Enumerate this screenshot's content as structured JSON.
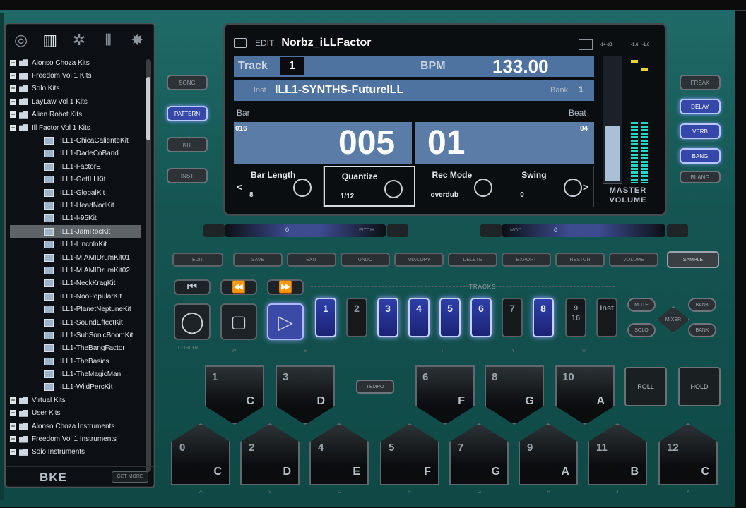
{
  "browser": {
    "tabs": [
      "disc-icon",
      "keyboard-icon",
      "gear-icon",
      "mixer-icon",
      "burst-icon"
    ],
    "items": [
      {
        "label": "Alonso Choza Kits",
        "type": "folder"
      },
      {
        "label": "Freedom Vol 1 Kits",
        "type": "folder"
      },
      {
        "label": "Solo Kits",
        "type": "folder"
      },
      {
        "label": "LayLaw Vol 1 Kits",
        "type": "folder"
      },
      {
        "label": "Alien Robot Kits",
        "type": "folder"
      },
      {
        "label": "Ill Factor Vol 1 Kits",
        "type": "folder"
      },
      {
        "label": "ILL1-ChicaCalienteKit",
        "type": "kit"
      },
      {
        "label": "ILL1-DadeCoBand",
        "type": "kit"
      },
      {
        "label": "ILL1-FactorE",
        "type": "kit"
      },
      {
        "label": "ILL1-GetILLKit",
        "type": "kit"
      },
      {
        "label": "ILL1-GlobalKit",
        "type": "kit"
      },
      {
        "label": "ILL1-HeadNodKit",
        "type": "kit"
      },
      {
        "label": "ILL1-I-95Kit",
        "type": "kit"
      },
      {
        "label": "ILL1-JamRocKit",
        "type": "kit",
        "selected": true
      },
      {
        "label": "ILL1-LincolnKit",
        "type": "kit"
      },
      {
        "label": "ILL1-MIAMIDrumKit01",
        "type": "kit"
      },
      {
        "label": "ILL1-MIAMIDrumKit02",
        "type": "kit"
      },
      {
        "label": "ILL1-NeckKragKit",
        "type": "kit"
      },
      {
        "label": "ILL1-NooPopularKit",
        "type": "kit"
      },
      {
        "label": "ILL1-PlanetNeptuneKit",
        "type": "kit"
      },
      {
        "label": "ILL1-SoundEffectKit",
        "type": "kit"
      },
      {
        "label": "ILL1-SubSonicBoomKit",
        "type": "kit"
      },
      {
        "label": "ILL1-TheBangFactor",
        "type": "kit"
      },
      {
        "label": "ILL1-TheBasics",
        "type": "kit"
      },
      {
        "label": "ILL1-TheMagicMan",
        "type": "kit"
      },
      {
        "label": "ILL1-WildPercKit",
        "type": "kit"
      },
      {
        "label": "Virtual Kits",
        "type": "folder"
      },
      {
        "label": "User Kits",
        "type": "folder"
      },
      {
        "label": "Alonso Choza Instruments",
        "type": "folder"
      },
      {
        "label": "Freedom Vol 1 Instruments",
        "type": "folder"
      },
      {
        "label": "Solo Instruments",
        "type": "folder"
      }
    ],
    "logo": "BKE",
    "footer_button": "GET MORE"
  },
  "display": {
    "edit_label": "EDIT",
    "name": "Norbz_iLLFactor",
    "track_label": "Track",
    "track_value": "1",
    "bpm_label": "BPM",
    "bpm_value": "133.00",
    "inst_label": "Inst",
    "inst_value": "ILL1-SYNTHS-FutureILL",
    "bank_label": "Bank",
    "bank_value": "1",
    "bar_label": "Bar",
    "beat_label": "Beat",
    "bar_total": "016",
    "bar_value": "005",
    "beat_value": "01",
    "beat_total": "04",
    "params": [
      {
        "label": "Bar Length",
        "value": "8"
      },
      {
        "label": "Quantize",
        "value": "1/12",
        "boxed": true
      },
      {
        "label": "Rec Mode",
        "value": "overdub"
      },
      {
        "label": "Swing",
        "value": "0"
      }
    ],
    "meter_labels": [
      "-14 dB",
      "-1.6",
      "-1.6"
    ],
    "master_label": "MASTER VOLUME",
    "meter_level": 0.45
  },
  "mode_buttons": [
    {
      "label": "SONG",
      "on": false
    },
    {
      "label": "PATTERN",
      "on": true
    },
    {
      "label": "KIT",
      "on": false
    },
    {
      "label": "INST",
      "on": false
    }
  ],
  "fx_buttons": [
    {
      "label": "FREAK",
      "on": false
    },
    {
      "label": "DELAY",
      "on": true
    },
    {
      "label": "VERB",
      "on": true
    },
    {
      "label": "BANG",
      "on": true
    },
    {
      "label": "BLANG",
      "on": false
    }
  ],
  "wheels": {
    "pitch": "PITCH",
    "mod": "MOD",
    "pitch_value": "0",
    "mod_value": "0"
  },
  "toolbar": [
    "EDIT",
    "SAVE",
    "EXIT",
    "UNDO",
    "MIXCOPY",
    "DELETE",
    "EXPORT",
    "RESTOR",
    "VOLUME",
    "SAMPLE"
  ],
  "transport": {
    "record_sub": "CORL+R"
  },
  "tracks_label": "TRACKS",
  "tracks": [
    {
      "label": "1",
      "on": true
    },
    {
      "label": "2",
      "on": false
    },
    {
      "label": "3",
      "on": true
    },
    {
      "label": "4",
      "on": true
    },
    {
      "label": "5",
      "on": true
    },
    {
      "label": "6",
      "on": true
    },
    {
      "label": "7",
      "on": false
    },
    {
      "label": "8",
      "on": true
    },
    {
      "label": "9\n16",
      "on": false
    },
    {
      "label": "Inst",
      "on": false
    }
  ],
  "right_controls": {
    "mute": "MUTE",
    "solo": "SOLO",
    "mixer": "MIXER",
    "bank_up": "BANK",
    "bank_down": "BANK"
  },
  "keys_row": [
    "W",
    "E",
    "T",
    "Y",
    "U"
  ],
  "top_pads": [
    {
      "num": "1",
      "note": "C"
    },
    {
      "num": "3",
      "note": "D"
    },
    {
      "num": "6",
      "note": "F"
    },
    {
      "num": "8",
      "note": "G"
    },
    {
      "num": "10",
      "note": "A"
    }
  ],
  "bottom_pads": [
    {
      "num": "0",
      "note": "C"
    },
    {
      "num": "2",
      "note": "D"
    },
    {
      "num": "4",
      "note": "E"
    },
    {
      "num": "5",
      "note": "F"
    },
    {
      "num": "7",
      "note": "G"
    },
    {
      "num": "9",
      "note": "A"
    },
    {
      "num": "11",
      "note": "B"
    },
    {
      "num": "12",
      "note": "C"
    }
  ],
  "pad_keys": [
    "A",
    "S",
    "D",
    "F",
    "G",
    "H",
    "J",
    "K"
  ],
  "tempo_button": "TEMPO",
  "roll_button": "ROLL",
  "hold_button": "HOLD"
}
